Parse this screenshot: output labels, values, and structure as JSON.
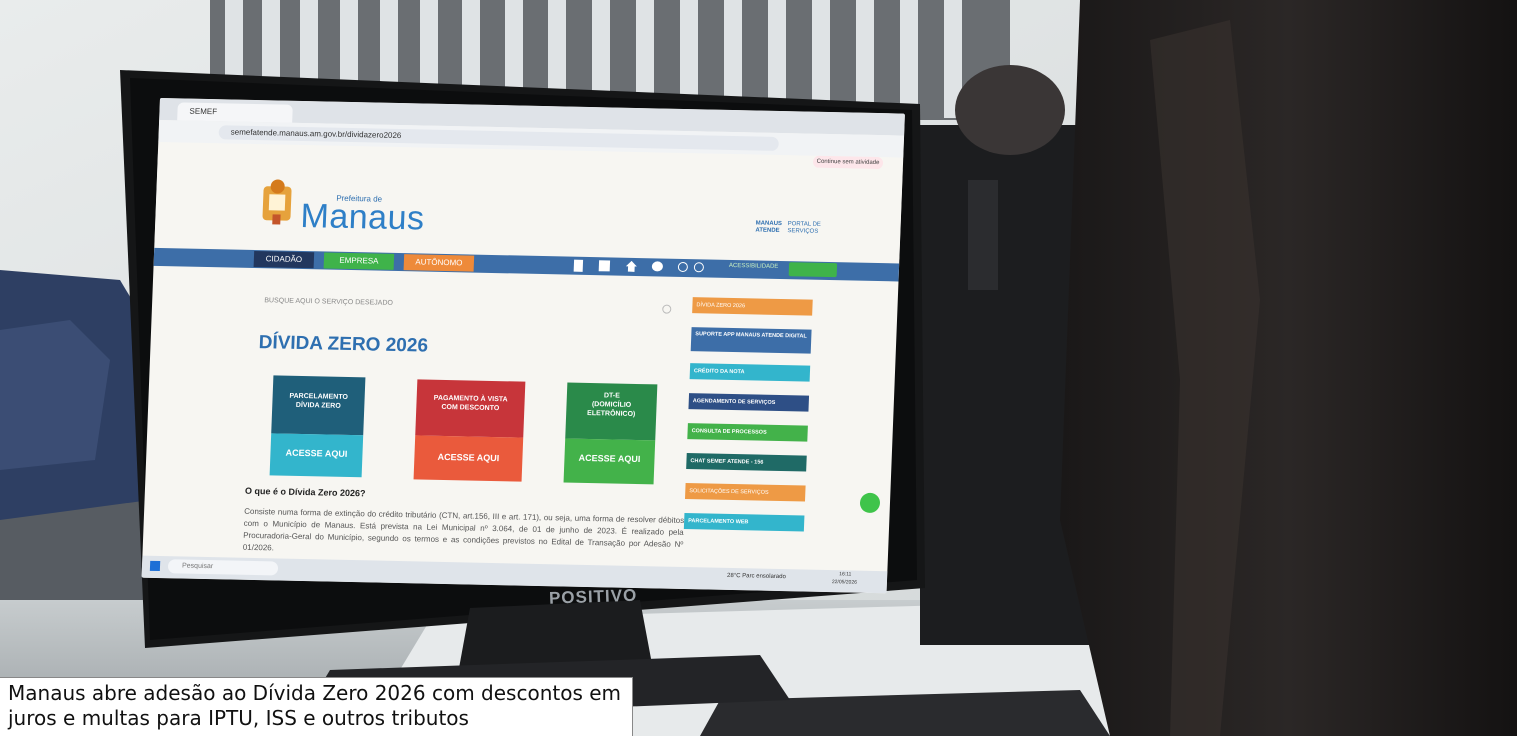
{
  "caption": "Manaus abre adesão ao Dívida Zero 2026 com descontos em juros e multas para IPTU, ISS e outros tributos",
  "browser": {
    "tab_title": "SEMEF",
    "url": "semefatende.manaus.am.gov.br/dividazero2026",
    "profile_label": "Continue sem atividade"
  },
  "site": {
    "logo_small": "Prefeitura de",
    "logo_big": "Manaus",
    "portal_left": "MANAUS\nATENDE",
    "portal_right": "PORTAL DE\nSERVIÇOS",
    "nav": [
      "CIDADÃO",
      "EMPRESA",
      "AUTÔNOMO"
    ],
    "accessibility": "ACESSIBILIDADE",
    "search_placeholder": "BUSQUE AQUI O SERVIÇO DESEJADO",
    "page_heading": "DÍVIDA ZERO 2026",
    "cards": [
      {
        "title": "PARCELAMENTO\nDÍVIDA ZERO",
        "cta": "ACESSE AQUI"
      },
      {
        "title": "PAGAMENTO À VISTA\nCOM DESCONTO",
        "cta": "ACESSE AQUI"
      },
      {
        "title": "DT-E\n(DOMICÍLIO\nELETRÔNICO)",
        "cta": "ACESSE AQUI"
      }
    ],
    "faq_title": "O que é o Dívida Zero 2026?",
    "faq_body": "Consiste numa forma de extinção do crédito tributário (CTN, art.156, III e art. 171), ou seja, uma forma de resolver débitos com o Município de Manaus. Está prevista na Lei Municipal nº 3.064, de 01 de junho de 2023. É realizado pela Procuradoria-Geral do Município, segundo os termos e as condições previstos no Edital de Transação por Adesão Nº 01/2026.",
    "sidebar": [
      "DÍVIDA ZERO 2026",
      "SUPORTE APP MANAUS ATENDE DIGITAL",
      "CRÉDITO DA NOTA",
      "AGENDAMENTO DE SERVIÇOS",
      "CONSULTA DE PROCESSOS",
      "CHAT SEMEF ATENDE - 156",
      "SOLICITAÇÕES DE SERVIÇOS",
      "PARCELAMENTO WEB"
    ]
  },
  "taskbar": {
    "search": "Pesquisar",
    "weather": "28°C Parc ensolarado",
    "time": "16:11",
    "date": "22/05/2026"
  },
  "monitor_brand": "POSITIVO",
  "colors": {
    "nav_bar": "#3d6ea8",
    "card_blue_top": "#1f5f7a",
    "card_blue_bottom": "#33b5cc",
    "card_red_top": "#c7353a",
    "card_red_bottom": "#ea5a3c",
    "card_green_top": "#2a8a4a",
    "card_green_bottom": "#43b24a",
    "heading": "#2e6fb0"
  }
}
